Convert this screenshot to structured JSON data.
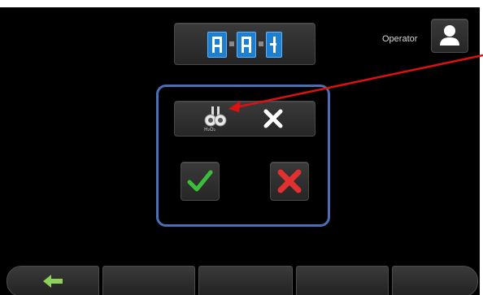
{
  "header": {
    "operator_label": "Operator",
    "status_icon": "chamber-status-icon",
    "operator_icon": "user-icon"
  },
  "dialog": {
    "agent_icon": "h2o2-sterilant-icon",
    "agent_subscript": "H₂O₂",
    "agent_state_icon": "x-mark-icon",
    "confirm_icon": "checkmark-icon",
    "cancel_icon": "red-x-icon"
  },
  "footer": {
    "back_icon": "back-arrow-icon"
  },
  "colors": {
    "screen_bg": "#000000",
    "dialog_border": "#4a6fb5",
    "status_blue": "#1e7fd0",
    "confirm_green": "#3bbf3b",
    "cancel_red": "#e03030",
    "back_green": "#8ed15a",
    "annotation_red": "#e01010"
  }
}
